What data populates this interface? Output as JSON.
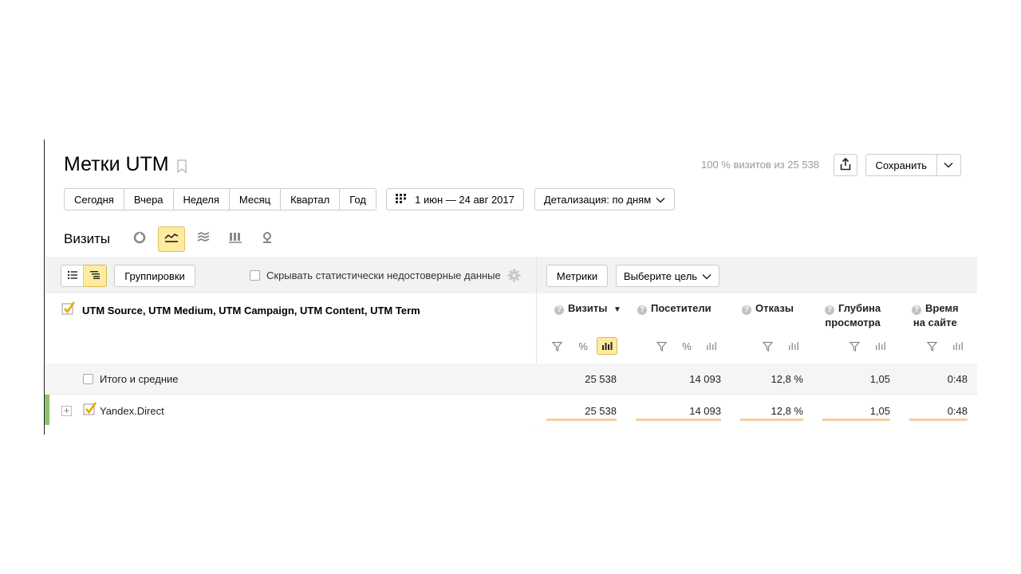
{
  "header": {
    "title": "Метки UTM",
    "summary": "100 % визитов из 25 538",
    "save_label": "Сохранить"
  },
  "periods": [
    "Сегодня",
    "Вчера",
    "Неделя",
    "Месяц",
    "Квартал",
    "Год"
  ],
  "date_range": "1 июн — 24 авг 2017",
  "detail_label": "Детализация: по дням",
  "chart_section": {
    "title": "Визиты",
    "active_chart_type": "line"
  },
  "toolbar": {
    "groupings_label": "Группировки",
    "hide_unreliable_label": "Скрывать статистически недостоверные данные",
    "metrics_label": "Метрики",
    "goal_label": "Выберите цель"
  },
  "table": {
    "dimensions_label": "UTM Source, UTM Medium, UTM Campaign, UTM Content, UTM Term",
    "columns": [
      {
        "line1": "Визиты",
        "line2": "",
        "sorted": true,
        "sort_indicator": "▼"
      },
      {
        "line1": "Посетители",
        "line2": ""
      },
      {
        "line1": "Отказы",
        "line2": ""
      },
      {
        "line1": "Глубина",
        "line2": "просмотра"
      },
      {
        "line1": "Время",
        "line2": "на сайте"
      }
    ],
    "totals": {
      "label": "Итого и средние",
      "values": [
        "25 538",
        "14 093",
        "12,8 %",
        "1,05",
        "0:48"
      ]
    },
    "rows": [
      {
        "label": "Yandex.Direct",
        "checked": true,
        "values": [
          "25 538",
          "14 093",
          "12,8 %",
          "1,05",
          "0:48"
        ]
      }
    ]
  },
  "colors": {
    "accent": "#ffeba0",
    "row_marker": "#8dc36a",
    "bar": "#f5cda0",
    "check": "#e8a800"
  }
}
